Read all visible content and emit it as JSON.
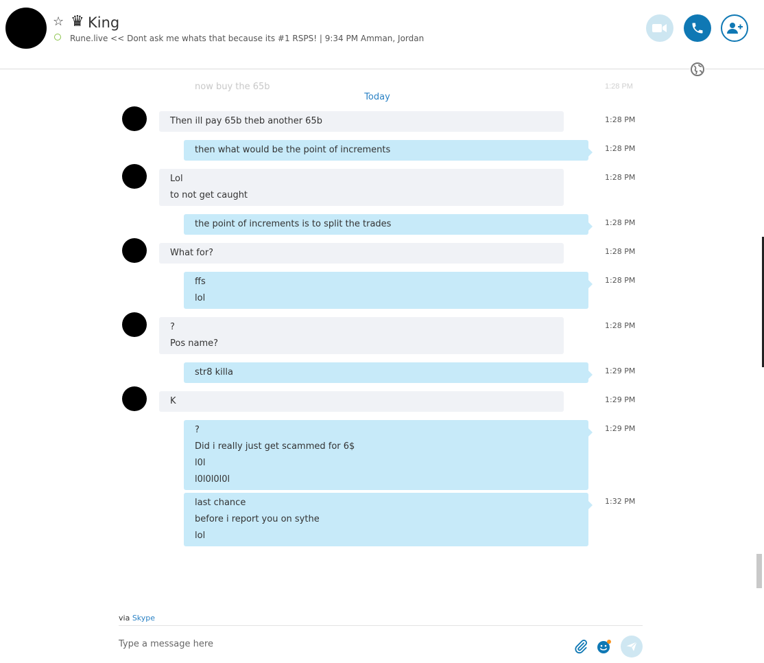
{
  "header": {
    "star_icon": "☆",
    "crown_icon": "♛",
    "name": "King",
    "mood": "Rune.live << Dont ask me whats that because its #1 RSPS! | 9:34 PM Amman, Jordan"
  },
  "chat": {
    "faded_text": "now buy the 65b",
    "faded_time": "1:28 PM",
    "date_divider": "Today",
    "messages": [
      {
        "dir": "in",
        "lines": [
          "Then ill pay 65b theb another 65b"
        ],
        "time": "1:28 PM"
      },
      {
        "dir": "out",
        "lines": [
          "then what would be the point of increments"
        ],
        "time": "1:28 PM"
      },
      {
        "dir": "in",
        "lines": [
          "Lol",
          "to not get caught"
        ],
        "time": "1:28 PM"
      },
      {
        "dir": "out",
        "lines": [
          "the point of increments is to split the trades"
        ],
        "time": "1:28 PM"
      },
      {
        "dir": "in",
        "lines": [
          "What for?"
        ],
        "time": "1:28 PM"
      },
      {
        "dir": "out",
        "lines": [
          "ffs",
          "lol"
        ],
        "time": "1:28 PM"
      },
      {
        "dir": "in",
        "lines": [
          "?",
          "Pos name?"
        ],
        "time": "1:28 PM"
      },
      {
        "dir": "out",
        "lines": [
          "str8 killa"
        ],
        "time": "1:29 PM"
      },
      {
        "dir": "in",
        "lines": [
          "K"
        ],
        "time": "1:29 PM"
      },
      {
        "dir": "out",
        "lines": [
          "?",
          "Did i really just get scammed for 6$",
          "l0l",
          "l0l0l0l0l"
        ],
        "time": "1:29 PM"
      },
      {
        "dir": "out",
        "lines": [
          "last chance",
          "before i report you on sythe",
          "lol"
        ],
        "time": "1:32 PM"
      }
    ]
  },
  "footer": {
    "via_prefix": "via",
    "via_link": "Skype",
    "input_placeholder": "Type a message here"
  },
  "colors": {
    "accent": "#0f78b4",
    "link": "#2b82c5",
    "outgoing_bubble": "#c7eaf9",
    "incoming_bubble": "#f0f2f6",
    "presence": "#8bc34a"
  }
}
